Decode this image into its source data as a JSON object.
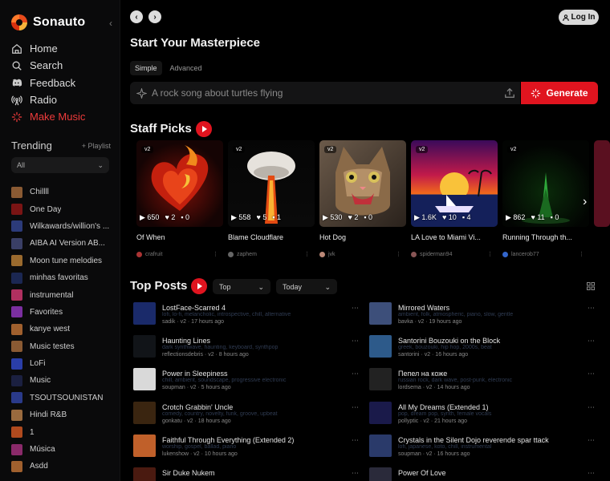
{
  "app": {
    "name": "Sonauto"
  },
  "nav": [
    {
      "label": "Home",
      "icon": "home-icon"
    },
    {
      "label": "Search",
      "icon": "search-icon"
    },
    {
      "label": "Feedback",
      "icon": "discord-icon"
    },
    {
      "label": "Radio",
      "icon": "radio-icon"
    },
    {
      "label": "Make Music",
      "icon": "sparkle-icon"
    }
  ],
  "trending": {
    "title": "Trending",
    "add_label": "+ Playlist",
    "filter": "All",
    "items": [
      "Chillll",
      "One Day",
      "Wilkawards/willion's ...",
      "AIBA AI Version AB...",
      "Moon tune melodies",
      "minhas favoritas",
      "instrumental",
      "Favorites",
      "kanye west",
      "Music testes",
      "LoFi",
      "Music",
      "TSOUTSOUNISTAN",
      "Hindi R&B",
      "1",
      "Música",
      "Asdd"
    ],
    "colors": [
      "#8a5a33",
      "#7a1414",
      "#2c3b7a",
      "#3a3f66",
      "#9a6a2e",
      "#1b2752",
      "#b03060",
      "#7b2fa0",
      "#a0602e",
      "#8a5a33",
      "#2a3ea8",
      "#1b2040",
      "#2a3a8a",
      "#9a6a3e",
      "#b04a1e",
      "#8a2a6a",
      "#a0602e"
    ]
  },
  "header": {
    "back": "‹",
    "forward": "›",
    "login": "Log In"
  },
  "create": {
    "title": "Start Your Masterpiece",
    "modes": [
      "Simple",
      "Advanced"
    ],
    "placeholder": "A rock song about turtles flying",
    "generate": "Generate"
  },
  "staff_picks": {
    "title": "Staff Picks",
    "cards": [
      {
        "version": "v2",
        "plays": "650",
        "likes": "2",
        "comments": "0",
        "title": "Of When",
        "user": "crafruit"
      },
      {
        "version": "v2",
        "plays": "558",
        "likes": "5",
        "comments": "1",
        "title": "Blame Cloudflare",
        "user": "zaphem"
      },
      {
        "version": "v2",
        "plays": "530",
        "likes": "2",
        "comments": "0",
        "title": "Hot Dog",
        "user": "jvk"
      },
      {
        "version": "v2",
        "plays": "1.6K",
        "likes": "10",
        "comments": "4",
        "title": "LA Love to Miami Vi...",
        "user": "spiderman94"
      },
      {
        "version": "v2",
        "plays": "862",
        "likes": "11",
        "comments": "0",
        "title": "Running Through th...",
        "user": "lancerob77"
      }
    ]
  },
  "top_posts": {
    "title": "Top Posts",
    "sort": "Top",
    "range": "Today",
    "posts": [
      {
        "title": "LostFace-Scarred 4",
        "desc": "lofi, lo-fi, melancholic, introspective, chill, alternative",
        "user": "sadik",
        "meta": "· v2 · 17 hours ago"
      },
      {
        "title": "Mirrored Waters",
        "desc": "ambient, folk, atmospheric, piano, slow, gentle",
        "user": "bavka",
        "meta": "· v2 · 19 hours ago"
      },
      {
        "title": "Haunting Lines",
        "desc": "dark synthwave, haunting, keyboard, synthpop",
        "user": "reflectionsdebris",
        "meta": "· v2 · 8 hours ago"
      },
      {
        "title": "Santorini Bouzouki on the Block",
        "desc": "greek, bouzouki, hip hop, 2000s, beat",
        "user": "santorini",
        "meta": "· v2 · 16 hours ago"
      },
      {
        "title": "Power in Sleepiness",
        "desc": "chill, ambient, soundscape, progressive electronic",
        "user": "soupman",
        "meta": "· v2 · 5 hours ago"
      },
      {
        "title": "Пепел на коже",
        "desc": "russian rock, dark wave, post-punk, electronic",
        "user": "lordsema",
        "meta": "· v2 · 14 hours ago"
      },
      {
        "title": "Crotch Grabbin' Uncle",
        "desc": "comedy, country, novelty, funk, groove, upbeat",
        "user": "gonkatu",
        "meta": "· v2 · 18 hours ago"
      },
      {
        "title": "All My Dreams (Extended 1)",
        "desc": "pop, dream pop, synth, female vocals",
        "user": "pollyptic",
        "meta": "· v2 · 21 hours ago"
      },
      {
        "title": "Faithful Through Everything (Extended 2)",
        "desc": "worship, gospel, ballad, piano",
        "user": "lukenshow",
        "meta": "· v2 · 10 hours ago"
      },
      {
        "title": "Crystals in the Silent Dojo reverende spar ttack",
        "desc": "lofi, japanese, koto, chill, instrumental",
        "user": "soupman",
        "meta": "· v2 · 16 hours ago"
      },
      {
        "title": "Sir Duke Nukem",
        "desc": "",
        "user": "",
        "meta": ""
      },
      {
        "title": "Power Of Love",
        "desc": "",
        "user": "",
        "meta": ""
      }
    ],
    "thumbs": [
      "#1a2a6a",
      "#3d4f7a",
      "#111418",
      "#2d5a8a",
      "#d9d9d9",
      "#222",
      "#3a2510",
      "#1a1a4a",
      "#c0602a",
      "#2a3a6a",
      "#4a1a10",
      "#2a2a3a"
    ]
  }
}
